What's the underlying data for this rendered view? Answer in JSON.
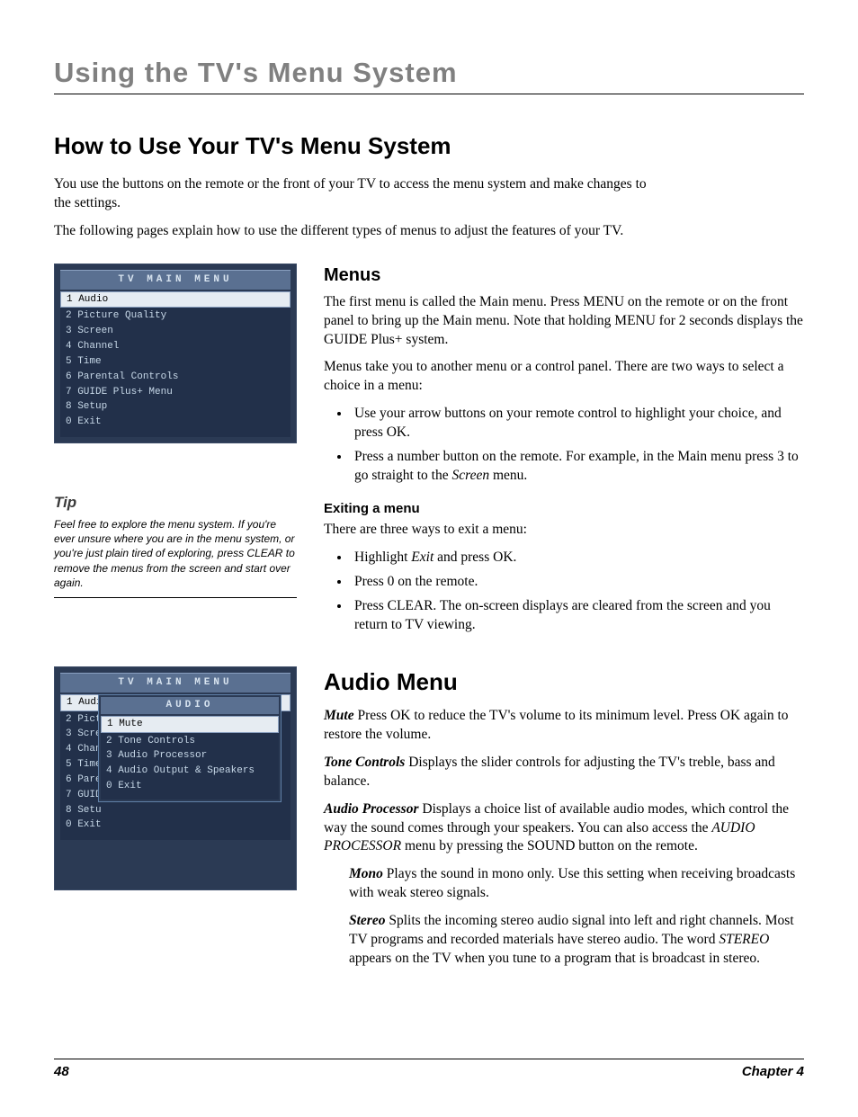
{
  "chapter_title": "Using the TV's Menu System",
  "page_title": "How to Use Your TV's Menu System",
  "intro_p1": "You use the buttons on the remote or the front of your TV to access the menu system and make changes to the settings.",
  "intro_p2": "The following pages explain how to use the different types of menus to adjust the features of your TV.",
  "tv_main_title": "TV MAIN MENU",
  "main_menu_items": [
    "1 Audio",
    "2 Picture Quality",
    "3 Screen",
    "4 Channel",
    "5 Time",
    "6 Parental Controls",
    "7 GUIDE Plus+ Menu",
    "8 Setup",
    "0 Exit"
  ],
  "tip_label": "Tip",
  "tip_text": "Feel free to explore the menu system. If you're ever unsure where you are in the menu system, or you're just plain tired of exploring, press CLEAR to remove the menus from the screen and start over again.",
  "menus_h": "Menus",
  "menus_p1": "The first menu is called the Main menu. Press MENU on the remote or on the front panel to bring up the Main menu. Note that holding MENU for 2 seconds displays the GUIDE Plus+ system.",
  "menus_p2": "Menus take you to another menu or a control panel. There are two ways to select a choice in a menu:",
  "menus_b1": "Use your arrow buttons on your remote control to highlight your choice, and press OK.",
  "menus_b2a": "Press a number button on the remote. For example, in the Main menu press 3 to go straight to the ",
  "menus_b2b": "Screen",
  "menus_b2c": " menu.",
  "exit_h": "Exiting a menu",
  "exit_p": "There are three ways to exit a menu:",
  "exit_b1a": "Highlight ",
  "exit_b1b": "Exit",
  "exit_b1c": " and press OK.",
  "exit_b2": "Press 0 on the remote.",
  "exit_b3": "Press CLEAR. The on-screen displays are cleared from the screen and you return to TV viewing.",
  "tv2_main_truncated": [
    "1 Audio",
    "2 Pict",
    "3 Scre",
    "4 Chan",
    "5 Time",
    "6 Pare",
    "7 GUID",
    "8 Setu",
    "0 Exit"
  ],
  "tv_audio_title": "AUDIO",
  "audio_submenu_items": [
    "1 Mute",
    "2 Tone Controls",
    "3 Audio Processor",
    "4 Audio Output & Speakers",
    "0 Exit"
  ],
  "audio_h": "Audio Menu",
  "mute_t": "Mute",
  "mute_d": "  Press OK to reduce the TV's volume to its minimum level. Press OK again to restore the volume.",
  "tone_t": "Tone Controls",
  "tone_d": "   Displays the slider controls for adjusting the TV's treble, bass and balance.",
  "ap_t": "Audio Processor",
  "ap_d1": "   Displays a choice list of available audio modes, which control the way the sound comes through your speakers. You can also access the ",
  "ap_d2": "AUDIO PROCESSOR",
  "ap_d3": " menu by pressing the SOUND button on the remote.",
  "mono_t": "Mono",
  "mono_d": "   Plays the sound in mono only. Use this setting when receiving broadcasts with weak stereo signals.",
  "stereo_t": "Stereo",
  "stereo_d1": "    Splits the incoming stereo audio signal into left and right channels. Most TV programs and recorded materials have stereo audio. The word ",
  "stereo_d2": "STEREO",
  "stereo_d3": " appears on the TV when you tune to a program that is broadcast in stereo.",
  "page_num": "48",
  "chapter_label": "Chapter 4"
}
